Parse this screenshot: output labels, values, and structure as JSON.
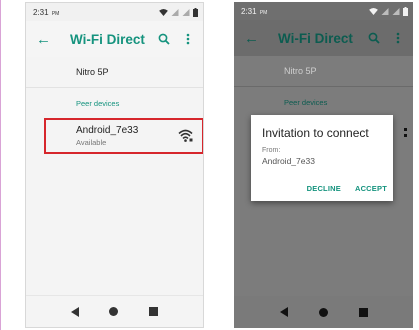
{
  "left_screen": {
    "status": {
      "time": "2:31",
      "ampm": "PM"
    },
    "appbar": {
      "title": "Wi-Fi Direct"
    },
    "device_name": "Nitro 5P",
    "section_label": "Peer devices",
    "peer": {
      "name": "Android_7e33",
      "status": "Available"
    }
  },
  "right_screen": {
    "status": {
      "time": "2:31",
      "ampm": "PM"
    },
    "appbar": {
      "title": "Wi-Fi Direct"
    },
    "device_name": "Nitro 5P",
    "section_label": "Peer devices",
    "dialog": {
      "title": "Invitation to connect",
      "from_label": "From:",
      "from_device": "Android_7e33",
      "decline_label": "DECLINE",
      "accept_label": "ACCEPT"
    }
  },
  "colors": {
    "accent": "#15937e",
    "accent_dimmed": "#0c5c50",
    "highlight": "#d6262c"
  },
  "icons": [
    "back-arrow-icon",
    "search-icon",
    "more-vert-icon",
    "wifi-signal-icon",
    "cell-signal-icon",
    "battery-icon"
  ]
}
